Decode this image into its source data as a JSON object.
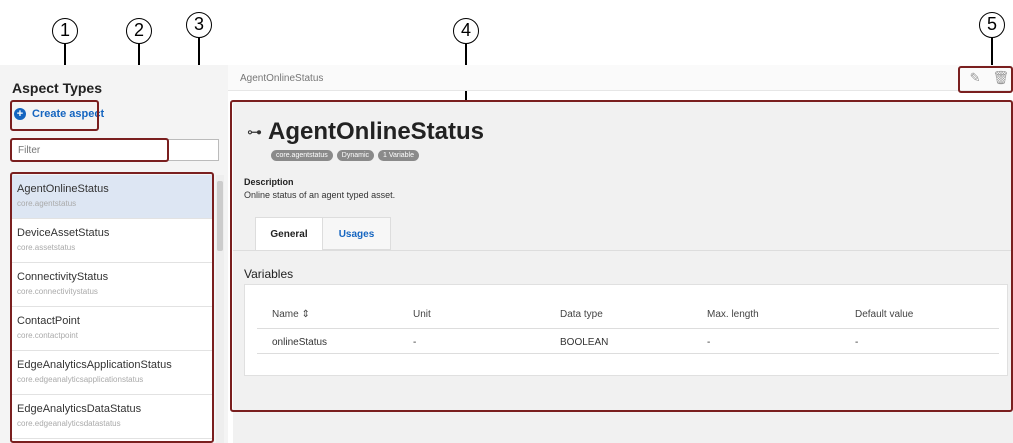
{
  "callouts": [
    "1",
    "2",
    "3",
    "4",
    "5"
  ],
  "sidebar": {
    "title": "Aspect Types",
    "create_label": "Create aspect",
    "filter_placeholder": "Filter",
    "items": [
      {
        "name": "AgentOnlineStatus",
        "sub": "core.agentstatus"
      },
      {
        "name": "DeviceAssetStatus",
        "sub": "core.assetstatus"
      },
      {
        "name": "ConnectivityStatus",
        "sub": "core.connectivitystatus"
      },
      {
        "name": "ContactPoint",
        "sub": "core.contactpoint"
      },
      {
        "name": "EdgeAnalyticsApplicationStatus",
        "sub": "core.edgeanalyticsapplicationstatus"
      },
      {
        "name": "EdgeAnalyticsDataStatus",
        "sub": "core.edgeanalyticsdatastatus"
      }
    ]
  },
  "topbar": {
    "breadcrumb": "AgentOnlineStatus"
  },
  "detail": {
    "title": "AgentOnlineStatus",
    "chips": [
      "core.agentstatus",
      "Dynamic",
      "1 Variable"
    ],
    "description_label": "Description",
    "description": "Online status of an agent typed asset.",
    "tabs": [
      "General",
      "Usages"
    ],
    "variables_heading": "Variables",
    "columns": [
      "Name",
      "Unit",
      "Data type",
      "Max. length",
      "Default value"
    ],
    "row": [
      "onlineStatus",
      "-",
      "BOOLEAN",
      "-",
      "-"
    ]
  },
  "colors": {
    "accent": "#1565c0",
    "highlight": "#7a1f1f",
    "selected": "#dde6f3"
  }
}
